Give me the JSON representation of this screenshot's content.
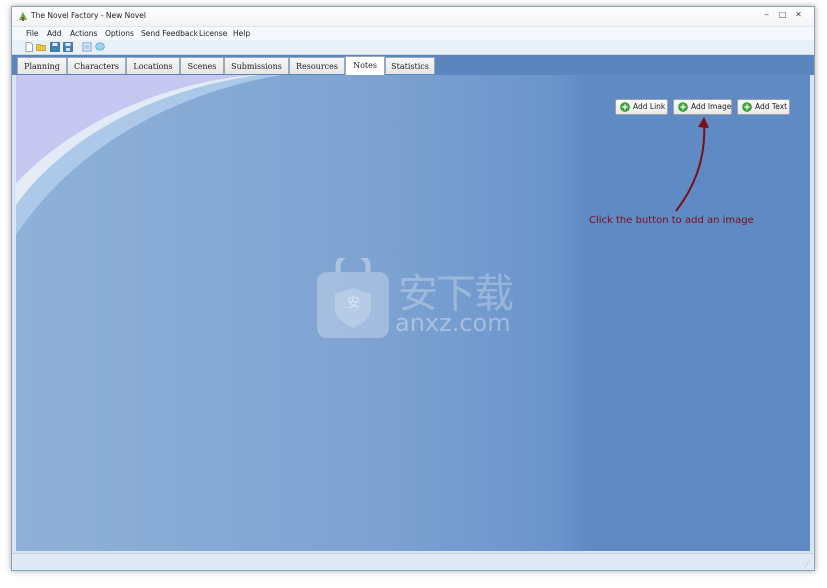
{
  "window": {
    "title": "The Novel Factory - New Novel",
    "controls": {
      "minimize": "‒",
      "maximize": "□",
      "close": "✕"
    }
  },
  "menu": [
    "File",
    "Add",
    "Actions",
    "Options",
    "Send Feedback",
    "License",
    "Help"
  ],
  "toolbar": {
    "icons": [
      "new-document-icon",
      "open-folder-icon",
      "save-icon",
      "save-as-icon",
      "print-preview-icon",
      "help-icon"
    ]
  },
  "tabs": [
    {
      "label": "Planning"
    },
    {
      "label": "Characters"
    },
    {
      "label": "Locations"
    },
    {
      "label": "Scenes"
    },
    {
      "label": "Submissions"
    },
    {
      "label": "Resources"
    },
    {
      "label": "Notes",
      "active": true
    },
    {
      "label": "Statistics"
    }
  ],
  "notes": {
    "add_link": "Add Link",
    "add_image": "Add Image",
    "add_text": "Add Text"
  },
  "annotation": {
    "text": "Click the button to add an image",
    "color": "#7a0f18"
  },
  "watermark": {
    "text_cn": "安下载",
    "text_en": "anxz.com",
    "badge": "安"
  },
  "colors": {
    "tab_strip": "#5b86bd",
    "content_blue": "#6a94cb",
    "button_plus": "#3fa83a"
  }
}
